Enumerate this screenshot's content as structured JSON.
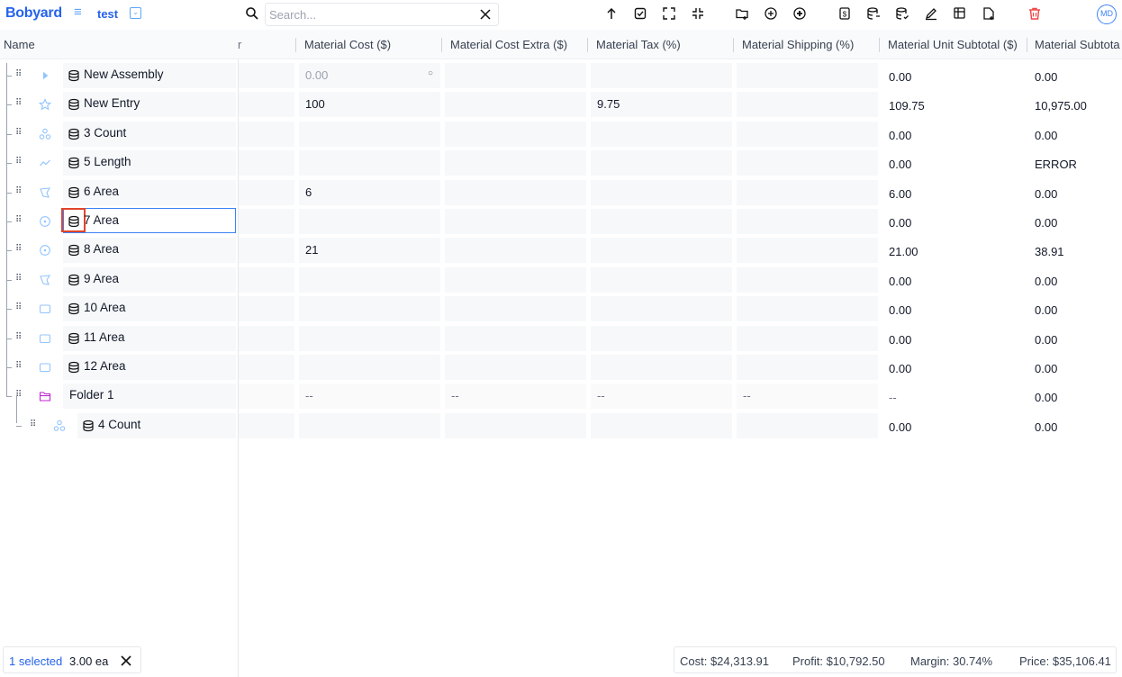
{
  "topbar": {
    "logo": "Bobyard",
    "project_name": "test",
    "search_placeholder": "Search..."
  },
  "columns": {
    "name": "Name",
    "partial": "r",
    "material_cost": "Material Cost ($)",
    "material_cost_extra": "Material Cost Extra ($)",
    "material_tax": "Material Tax (%)",
    "material_shipping": "Material Shipping (%)",
    "material_unit_subtotal": "Material Unit Subtotal ($)",
    "material_subtotal": "Material Subtota"
  },
  "rows": [
    {
      "name": "New Assembly",
      "type_icon": "chevron-right-icon",
      "db_icon": true,
      "cost": "0.00",
      "cost_placeholder": true,
      "cost_extra": "",
      "tax": "",
      "shipping": "",
      "unit_subtotal": "0.00",
      "subtotal": "0.00"
    },
    {
      "name": "New Entry",
      "type_icon": "star-icon",
      "db_icon": true,
      "cost": "100",
      "cost_extra": "",
      "tax": "9.75",
      "shipping": "",
      "unit_subtotal": "109.75",
      "subtotal": "10,975.00"
    },
    {
      "name": "3 Count",
      "type_icon": "count-icon",
      "db_icon": true,
      "cost": "",
      "cost_extra": "",
      "tax": "",
      "shipping": "",
      "unit_subtotal": "0.00",
      "subtotal": "0.00"
    },
    {
      "name": "5 Length",
      "type_icon": "length-icon",
      "db_icon": true,
      "cost": "",
      "cost_extra": "",
      "tax": "",
      "shipping": "",
      "unit_subtotal": "0.00",
      "subtotal": "ERROR"
    },
    {
      "name": "6 Area",
      "type_icon": "polygon-area-icon",
      "db_icon": true,
      "cost": "6",
      "cost_extra": "",
      "tax": "",
      "shipping": "",
      "unit_subtotal": "6.00",
      "subtotal": "0.00"
    },
    {
      "name": "7 Area",
      "type_icon": "circle-area-icon",
      "db_icon": true,
      "cost": "",
      "cost_extra": "",
      "tax": "",
      "shipping": "",
      "unit_subtotal": "0.00",
      "subtotal": "0.00"
    },
    {
      "name": "8 Area",
      "type_icon": "circle-area-icon",
      "db_icon": true,
      "cost": "21",
      "cost_extra": "",
      "tax": "",
      "shipping": "",
      "unit_subtotal": "21.00",
      "subtotal": "38.91"
    },
    {
      "name": "9 Area",
      "type_icon": "polygon-area-icon",
      "db_icon": true,
      "cost": "",
      "cost_extra": "",
      "tax": "",
      "shipping": "",
      "unit_subtotal": "0.00",
      "subtotal": "0.00"
    },
    {
      "name": "10 Area",
      "type_icon": "rectangle-area-icon",
      "db_icon": true,
      "cost": "",
      "cost_extra": "",
      "tax": "",
      "shipping": "",
      "unit_subtotal": "0.00",
      "subtotal": "0.00"
    },
    {
      "name": "11 Area",
      "type_icon": "rectangle-area-icon",
      "db_icon": true,
      "cost": "",
      "cost_extra": "",
      "tax": "",
      "shipping": "",
      "unit_subtotal": "0.00",
      "subtotal": "0.00"
    },
    {
      "name": "12 Area",
      "type_icon": "rectangle-area-icon",
      "db_icon": true,
      "cost": "",
      "cost_extra": "",
      "tax": "",
      "shipping": "",
      "unit_subtotal": "0.00",
      "subtotal": "0.00"
    },
    {
      "name": "Folder 1",
      "type_icon": "folder-icon",
      "db_icon": false,
      "cost": "--",
      "cost_extra": "--",
      "tax": "--",
      "shipping": "--",
      "unit_subtotal": "--",
      "subtotal": "0.00"
    },
    {
      "name": "4 Count",
      "type_icon": "count-icon",
      "db_icon": true,
      "cost": "",
      "cost_extra": "",
      "tax": "",
      "shipping": "",
      "unit_subtotal": "0.00",
      "subtotal": "0.00"
    }
  ],
  "footer": {
    "selected": "1 selected",
    "quantity": "3.00 ea",
    "cost": "Cost: $24,313.91",
    "profit": "Profit: $10,792.50",
    "margin": "Margin: 30.74%",
    "price": "Price: $35,106.41"
  },
  "colors": {
    "accent": "#2563eb",
    "highlight": "#e0442b",
    "folder": "#c026d3",
    "count": "#a855f7",
    "delete": "#ef4444"
  }
}
